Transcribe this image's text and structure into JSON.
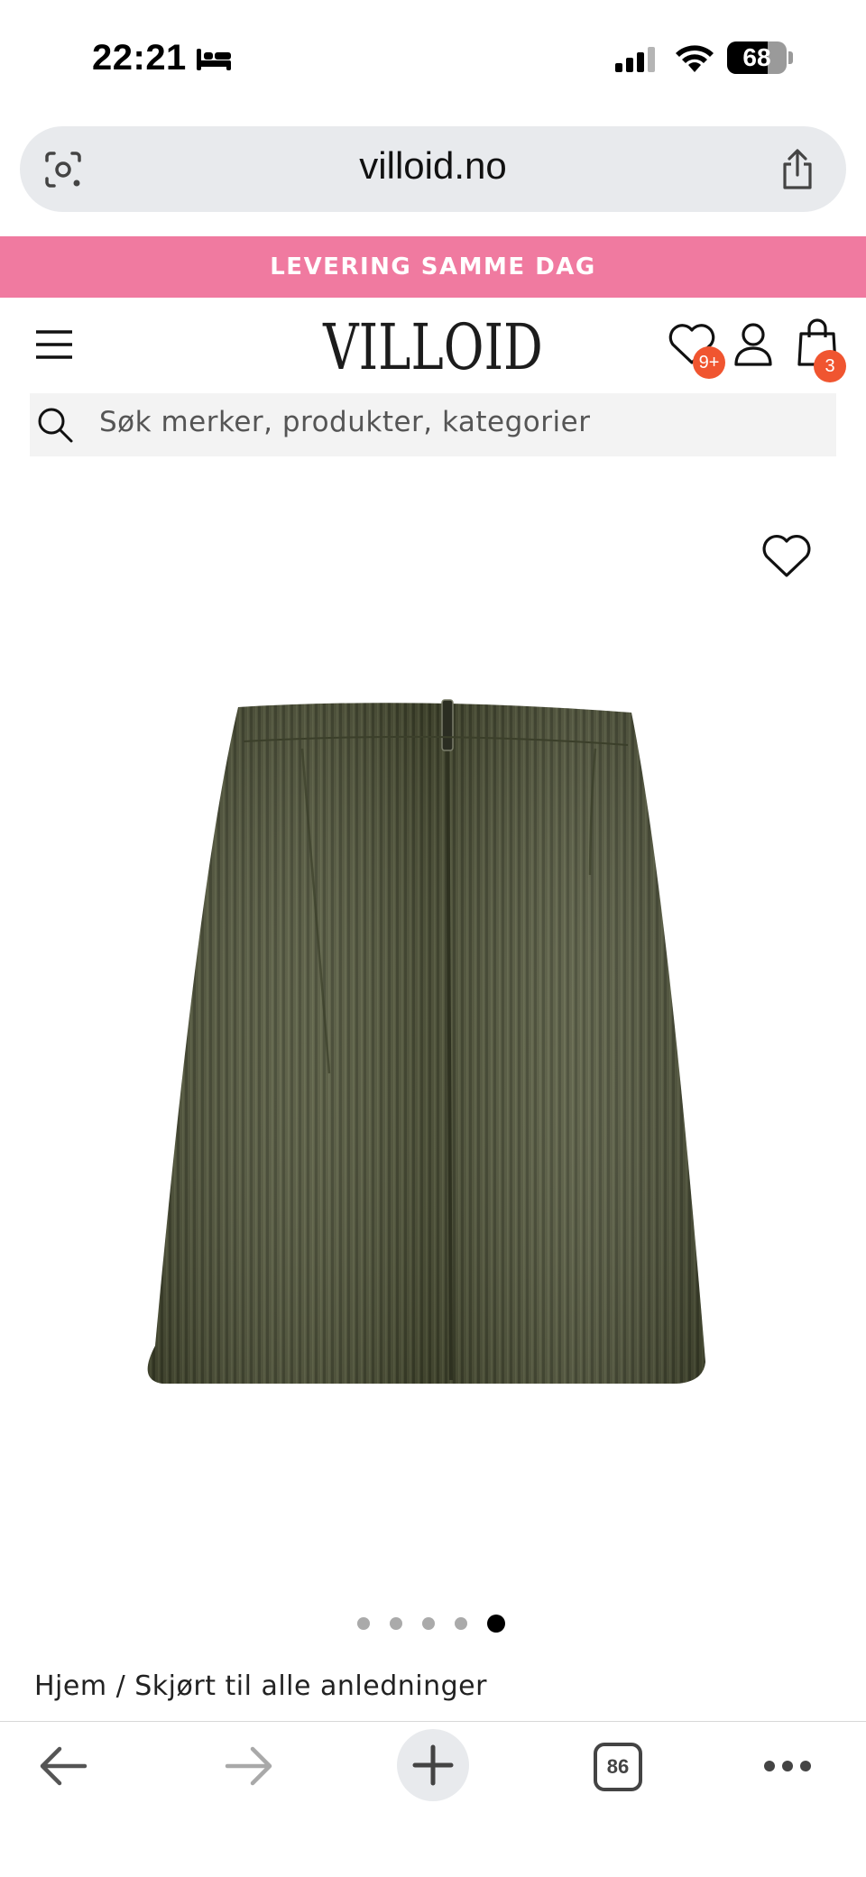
{
  "status_bar": {
    "time": "22:21",
    "battery_percent": "68",
    "battery_level": 0.68,
    "icons": [
      "bed-icon",
      "cellular-signal-icon",
      "wifi-icon",
      "battery-icon"
    ]
  },
  "browser": {
    "url": "villoid.no",
    "icons": [
      "lens-icon",
      "share-icon"
    ]
  },
  "promo_banner": {
    "text": "LEVERING SAMME DAG",
    "color": "#f07aa0"
  },
  "header": {
    "logo": "VILLOID",
    "wishlist_badge": "9+",
    "bag_badge": "3",
    "badge_color": "#f05530",
    "icons": [
      "menu-icon",
      "heart-icon",
      "user-icon",
      "shopping-bag-icon"
    ]
  },
  "search": {
    "placeholder": "Søk merker, produkter, kategorier"
  },
  "product": {
    "image_description_icon": "skirt-image",
    "image_color": "#4e5238",
    "carousel": {
      "total": 5,
      "active_index": 4
    }
  },
  "breadcrumb": {
    "text": "Hjem / Skjørt til alle anledninger"
  },
  "bottom_nav": {
    "tab_count": "86",
    "icons": [
      "back-arrow-icon",
      "forward-arrow-icon",
      "plus-icon",
      "tabs-icon",
      "more-icon"
    ]
  }
}
